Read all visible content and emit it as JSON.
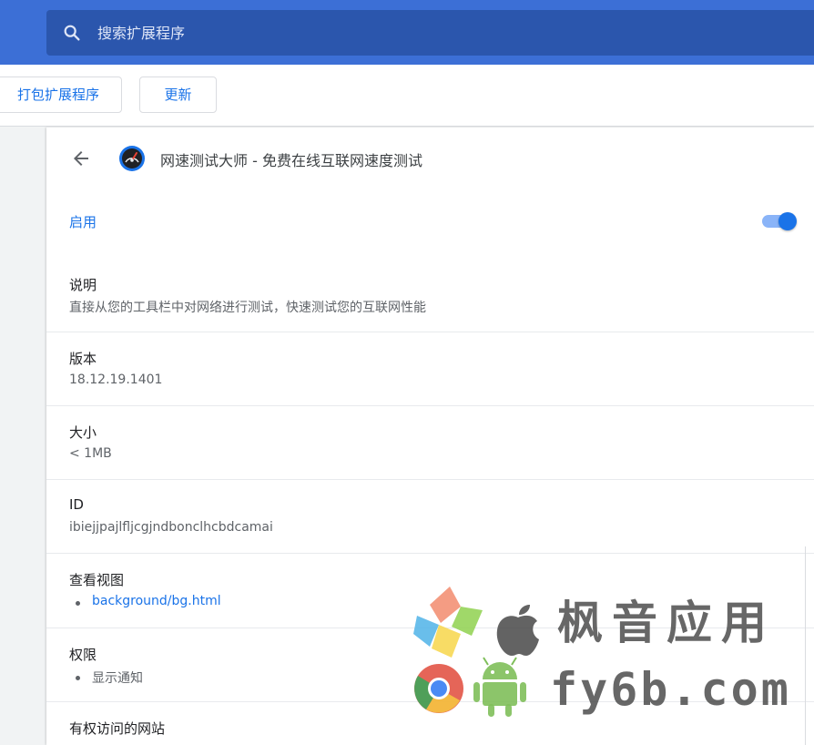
{
  "search": {
    "placeholder": "搜索扩展程序",
    "icon": "search-icon"
  },
  "toolbar": {
    "pack_label": "打包扩展程序",
    "update_label": "更新"
  },
  "extension": {
    "title": "网速测试大师 - 免费在线互联网速度测试",
    "icon": "speedometer-icon",
    "enabled_label": "启用",
    "enabled": true
  },
  "details": {
    "description_label": "说明",
    "description_value": "直接从您的工具栏中对网络进行测试，快速测试您的互联网性能",
    "version_label": "版本",
    "version_value": "18.12.19.1401",
    "size_label": "大小",
    "size_value": "< 1MB",
    "id_label": "ID",
    "id_value": "ibiejjpajlfljcgjndbonclhcbdcamai",
    "views_label": "查看视图",
    "views": [
      "background/bg.html"
    ],
    "permissions_label": "权限",
    "permissions": [
      "显示通知"
    ],
    "sites_label": "有权访问的网站"
  },
  "watermark": {
    "brand_cn": "枫音应用",
    "brand_url": "fy6b.com"
  },
  "colors": {
    "accent": "#1a73e8",
    "topbar": "#3c6fd6",
    "search_bg": "#2b56ad"
  }
}
